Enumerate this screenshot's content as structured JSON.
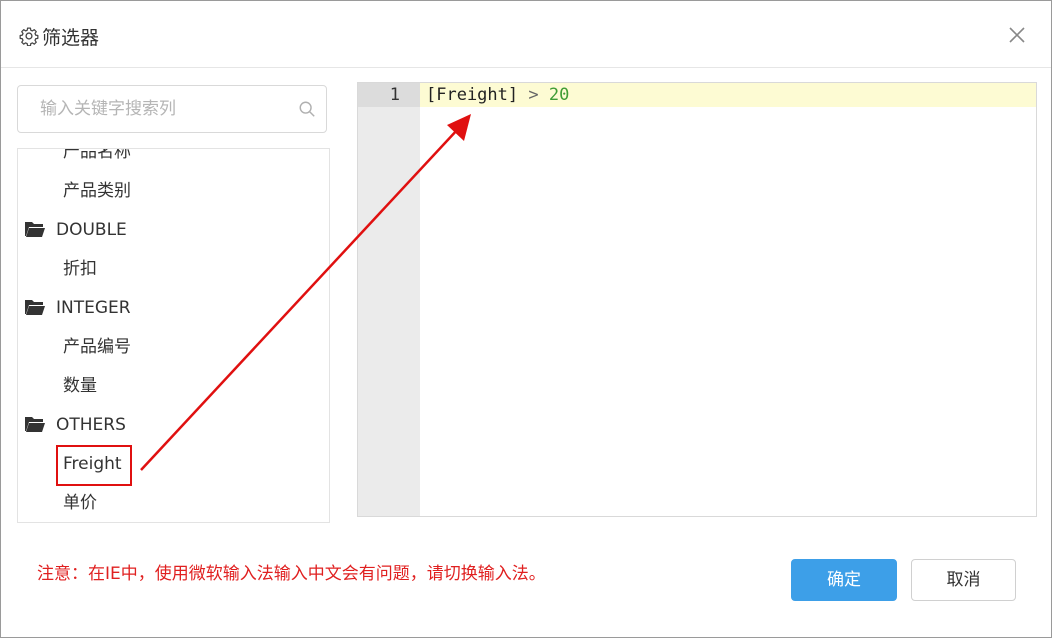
{
  "dialog": {
    "title": "筛选器",
    "title_icon": "gear-icon",
    "close_icon": "close-icon"
  },
  "search": {
    "placeholder": "输入关键字搜索列",
    "value": "",
    "icon": "search-icon"
  },
  "tree": {
    "items": [
      {
        "type": "leaf",
        "label": "产品名称"
      },
      {
        "type": "leaf",
        "label": "产品类别"
      },
      {
        "type": "folder",
        "label": "DOUBLE"
      },
      {
        "type": "leaf",
        "label": "折扣"
      },
      {
        "type": "folder",
        "label": "INTEGER"
      },
      {
        "type": "leaf",
        "label": "产品编号"
      },
      {
        "type": "leaf",
        "label": "数量"
      },
      {
        "type": "folder",
        "label": "OTHERS"
      },
      {
        "type": "leaf",
        "label": "Freight"
      },
      {
        "type": "leaf",
        "label": "单价"
      }
    ]
  },
  "editor": {
    "line_number": "1",
    "tokens": {
      "field": "[Freight]",
      "operator": ">",
      "number": "20"
    }
  },
  "footer": {
    "notice": "注意：在IE中，使用微软输入法输入中文会有问题，请切换输入法。",
    "ok_label": "确定",
    "cancel_label": "取消"
  },
  "colors": {
    "primary": "#3d9fe8",
    "notice": "#e02020",
    "annotation": "#e01010",
    "active_line": "#fdfbd3",
    "number_token": "#3f9c35"
  }
}
